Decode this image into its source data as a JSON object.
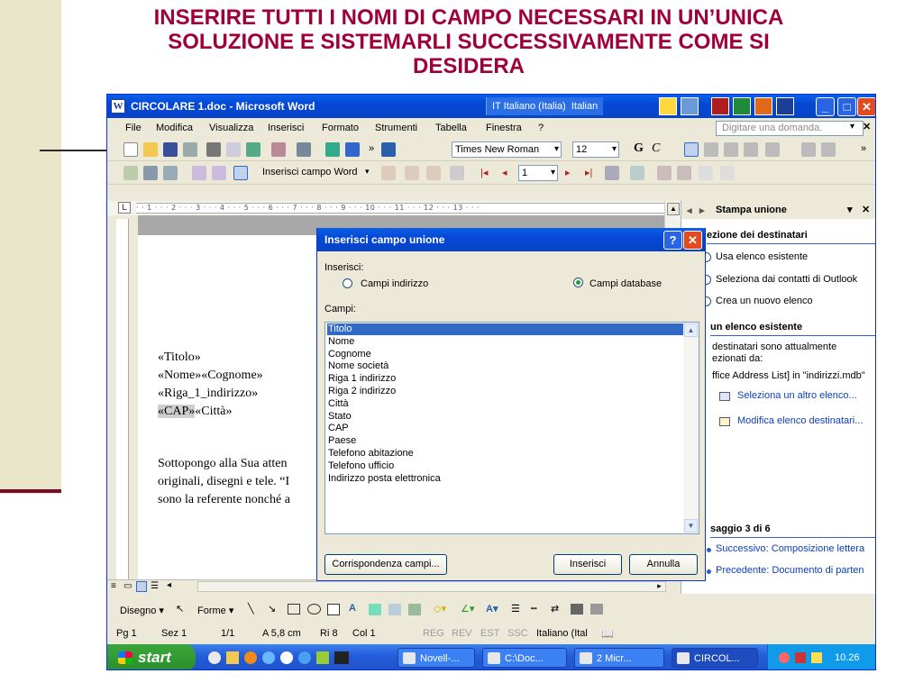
{
  "slide": {
    "title": "INSERIRE TUTTI I NOMI DI CAMPO NECESSARI IN UN’UNICA\nSOLUZIONE E SISTEMARLI SUCCESSIVAMENTE COME SI\nDESIDERA"
  },
  "window": {
    "title": "CIRCOLARE 1.doc - Microsoft Word",
    "language": "IT Italiano (Italia)",
    "language_short": "Italian",
    "ask_placeholder": "Digitare una domanda."
  },
  "menu": [
    "File",
    "Modifica",
    "Visualizza",
    "Inserisci",
    "Formato",
    "Strumenti",
    "Tabella",
    "Finestra",
    "?"
  ],
  "toolbar": {
    "font": "Times New Roman",
    "size": "12",
    "bold": "G",
    "italic": "C",
    "merge_field": "Inserisci campo Word",
    "record": "1"
  },
  "ruler": "· · 1 · · · 2 · · · 3 · · · 4 · · · 5 · · · 6 · · · 7 · · · 8 · · · 9 · · · 10 · · · 11 · · · 12 · · · 13 · · ·",
  "document": {
    "lines": [
      "«Titolo»",
      "«Nome»«Cognome»",
      "«Riga_1_indirizzo»"
    ],
    "cap": "«CAP»",
    "citta": "«Città»",
    "body": [
      "Sottopongo alla Sua atten",
      "originali, disegni e tele. “I",
      "sono la referente nonché a"
    ]
  },
  "taskpane": {
    "title": "Stampa unione",
    "section1": "ezione dei destinatari",
    "options": [
      "Usa elenco esistente",
      "Seleziona dai contatti di Outlook",
      "Crea un nuovo elenco"
    ],
    "section2": "un elenco esistente",
    "info": [
      "destinatari sono attualmente",
      "ezionati da:",
      "ffice Address List] in \"indirizzi.mdb\""
    ],
    "link1": "Seleziona un altro elenco...",
    "link2": "Modifica elenco destinatari...",
    "step": "saggio 3 di 6",
    "next": "Successivo: Composizione lettera",
    "prev": "Precedente: Documento di parten"
  },
  "drawbar": {
    "draw": "Disegno",
    "shapes": "Forme"
  },
  "status": {
    "page": "Pg 1",
    "section": "Sez 1",
    "pages": "1/1",
    "at": "A 5,8 cm",
    "line": "Ri 8",
    "col": "Col 1",
    "rec": "REG",
    "trk": "REV",
    "ext": "EST",
    "ovr": "SSC",
    "lang": "Italiano (Ital"
  },
  "taskbar": {
    "start": "start",
    "tasks": [
      "Novell-...",
      "C:\\Doc...",
      "2 Micr...",
      "CIRCOL..."
    ],
    "clock": "10.26"
  },
  "dialog": {
    "title": "Inserisci campo unione",
    "insert_label": "Inserisci:",
    "radio_address": "Campi indirizzo",
    "radio_db": "Campi database",
    "fields_label": "Campi:",
    "fields": [
      "Titolo",
      "Nome",
      "Cognome",
      "Nome società",
      "Riga 1 indirizzo",
      "Riga 2 indirizzo",
      "Città",
      "Stato",
      "CAP",
      "Paese",
      "Telefono abitazione",
      "Telefono ufficio",
      "Indirizzo posta elettronica"
    ],
    "match_button": "Corrispondenza campi...",
    "insert_button": "Inserisci",
    "cancel_button": "Annulla"
  }
}
